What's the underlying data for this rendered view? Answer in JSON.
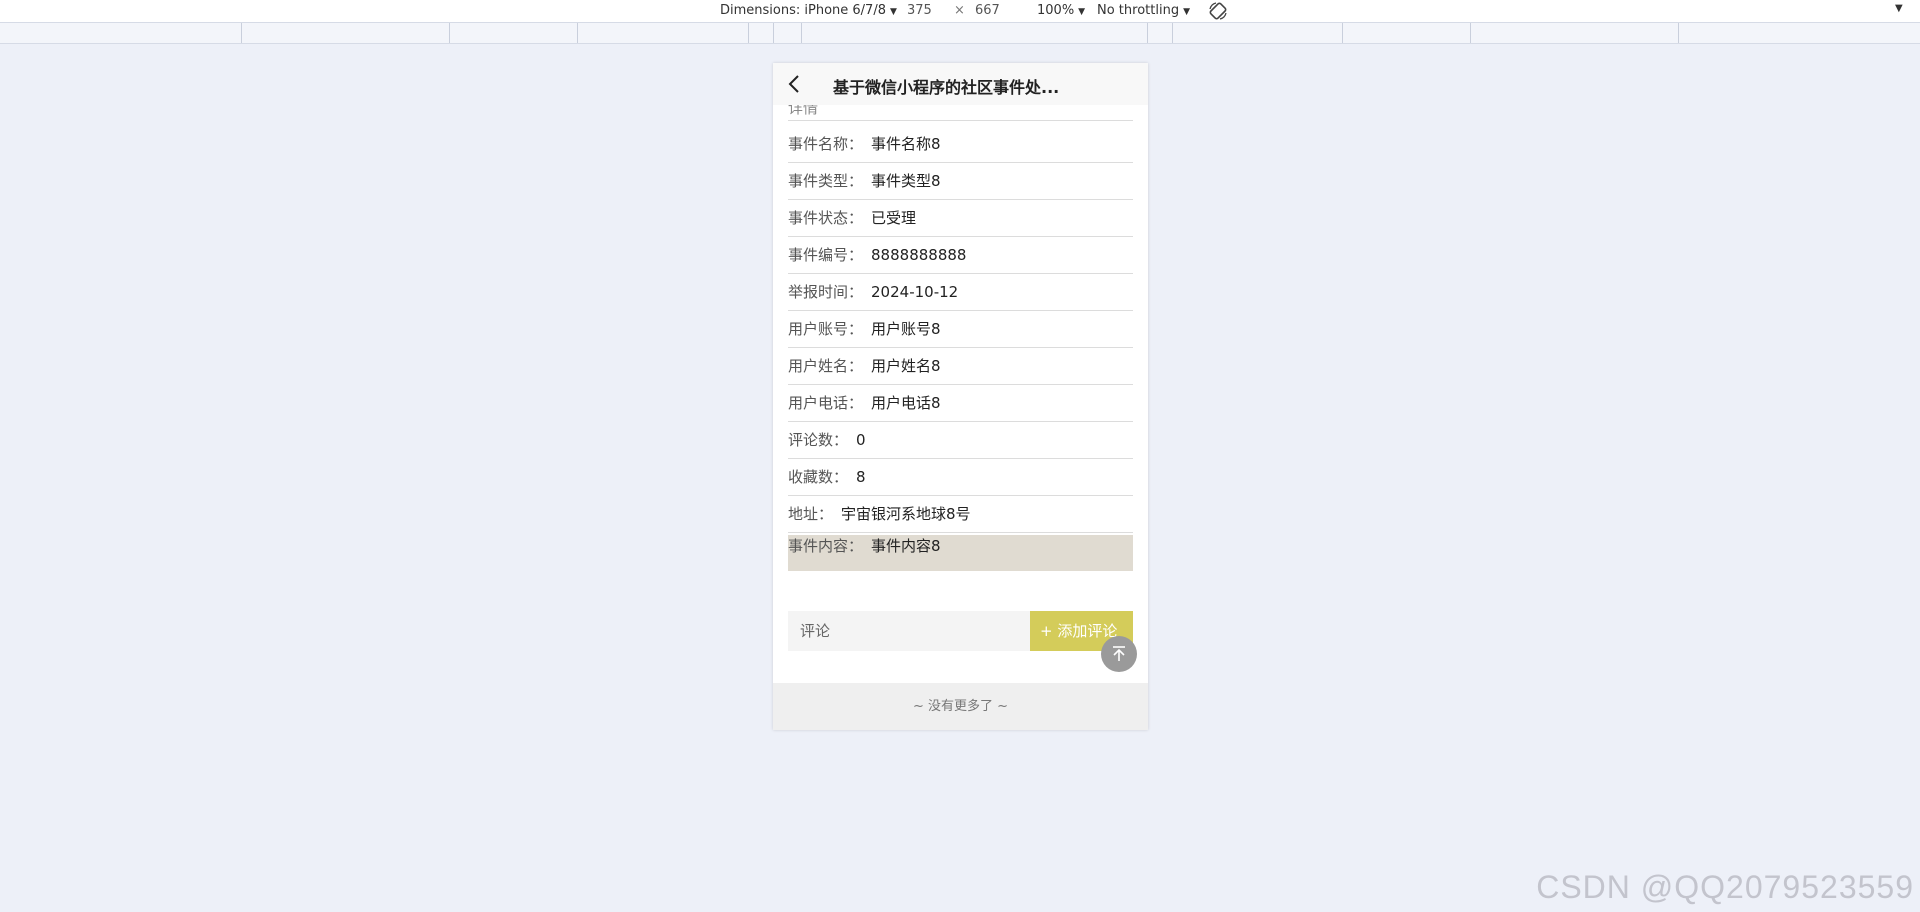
{
  "devtools": {
    "dimensions_label": "Dimensions: iPhone 6/7/8",
    "width": "375",
    "times": "×",
    "height": "667",
    "zoom": "100%",
    "throttling": "No throttling",
    "caret": "▼"
  },
  "nav": {
    "title": "基于微信小程序的社区事件处..."
  },
  "partial_row_label": "详情",
  "details": [
    {
      "label": "事件名称：",
      "value": "事件名称8"
    },
    {
      "label": "事件类型：",
      "value": "事件类型8"
    },
    {
      "label": "事件状态：",
      "value": "已受理"
    },
    {
      "label": "事件编号：",
      "value": "8888888888"
    },
    {
      "label": "举报时间：",
      "value": "2024-10-12"
    },
    {
      "label": "用户账号：",
      "value": "用户账号8"
    },
    {
      "label": "用户姓名：",
      "value": "用户姓名8"
    },
    {
      "label": "用户电话：",
      "value": "用户电话8"
    },
    {
      "label": "评论数：",
      "value": "0"
    },
    {
      "label": "收藏数：",
      "value": "8"
    },
    {
      "label": "地址：",
      "value": "宇宙银河系地球8号"
    },
    {
      "label": "事件内容：",
      "value": "事件内容8"
    }
  ],
  "comment": {
    "placeholder": "评论",
    "add_button": "+ 添加评论"
  },
  "footer": "~ 没有更多了 ~",
  "watermark": "CSDN @QQ2079523559",
  "colors": {
    "accent": "#d4cc5a",
    "highlight": "#e0dbd1",
    "background": "#edf0f8"
  }
}
